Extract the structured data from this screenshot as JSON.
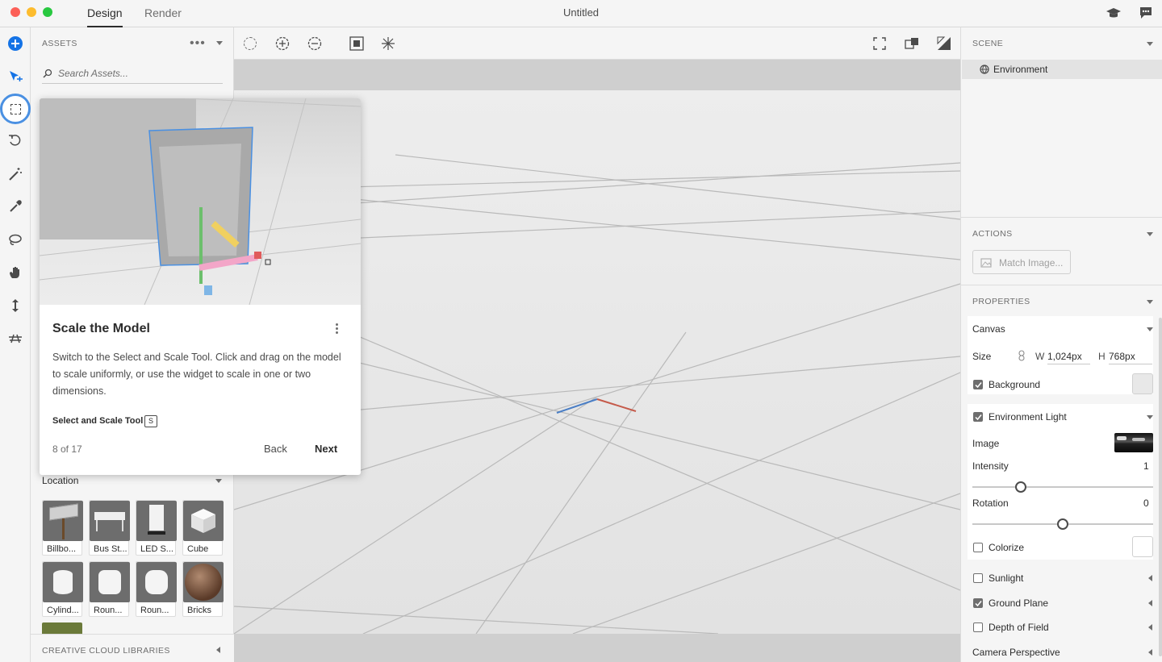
{
  "window": {
    "title": "Untitled"
  },
  "tabs": [
    {
      "label": "Design",
      "active": true
    },
    {
      "label": "Render",
      "active": false
    }
  ],
  "titlebar_icons": [
    "learn-icon",
    "feedback-icon"
  ],
  "toolbar": {
    "tools": [
      "add-icon",
      "move-icon",
      "select-scale-icon",
      "rotate-icon",
      "magic-wand-icon",
      "eyedropper-icon",
      "lasso-icon",
      "hand-icon",
      "dolly-icon",
      "horizon-icon"
    ]
  },
  "assets": {
    "header": "ASSETS",
    "search_placeholder": "Search Assets...",
    "location_label": "Location",
    "items": [
      {
        "label": "Billbo..."
      },
      {
        "label": "Bus St..."
      },
      {
        "label": "LED S..."
      },
      {
        "label": "Cube"
      },
      {
        "label": "Cylind..."
      },
      {
        "label": "Roun..."
      },
      {
        "label": "Roun..."
      },
      {
        "label": "Bricks"
      }
    ],
    "cc_libraries": "CREATIVE CLOUD LIBRARIES"
  },
  "tutorial": {
    "title": "Scale the Model",
    "body": "Switch to the Select and Scale Tool. Click and drag on the model to scale uniformly, or use the widget to scale in one or two dimensions.",
    "tool_name": "Select and Scale Tool",
    "shortcut": "S",
    "progress": "8 of 17",
    "back_label": "Back",
    "next_label": "Next"
  },
  "scene": {
    "header": "SCENE",
    "items": [
      {
        "label": "Environment"
      }
    ]
  },
  "actions": {
    "header": "ACTIONS",
    "match_image_label": "Match Image..."
  },
  "properties": {
    "header": "PROPERTIES",
    "canvas_label": "Canvas",
    "size_label": "Size",
    "w_label": "W",
    "width_value": "1,024px",
    "h_label": "H",
    "height_value": "768px",
    "background_label": "Background",
    "background_checked": true,
    "env_light_label": "Environment Light",
    "env_light_checked": true,
    "image_label": "Image",
    "intensity_label": "Intensity",
    "intensity_value": "1",
    "intensity_level": 0.27,
    "rotation_label": "Rotation",
    "rotation_value": "0",
    "rotation_level": 0.5,
    "colorize_label": "Colorize",
    "colorize_checked": false,
    "sunlight_label": "Sunlight",
    "sunlight_checked": false,
    "ground_plane_label": "Ground Plane",
    "ground_plane_checked": true,
    "dof_label": "Depth of Field",
    "dof_checked": false,
    "camera_label": "Camera Perspective"
  },
  "colors": {
    "accent": "#1473e6",
    "panel": "#f5f5f5",
    "viewport": "#e6e6e6"
  }
}
